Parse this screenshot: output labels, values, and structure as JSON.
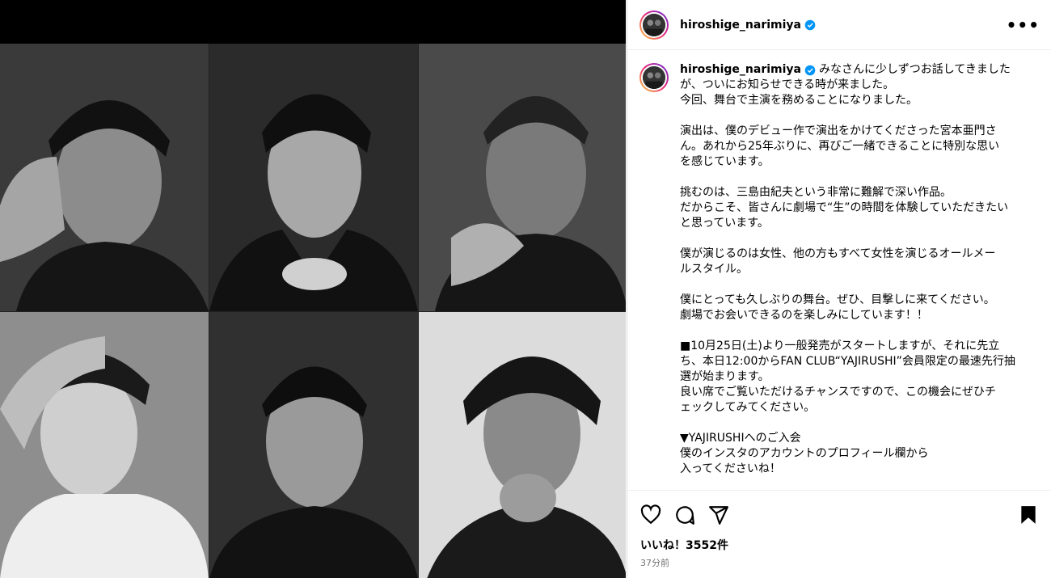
{
  "post": {
    "username": "hiroshige_narimiya",
    "verified": true,
    "more_icon": "more-horizontal-icon"
  },
  "caption": {
    "first_line": "みなさんに少しずつお話してきました",
    "lines": [
      "が、ついにお知らせできる時が来ました。",
      "今回、舞台で主演を務めることになりました。",
      "",
      "演出は、僕のデビュー作で演出をかけてくださった宮本亜門さ",
      "ん。あれから25年ぶりに、再びご一緒できることに特別な思い",
      "を感じています。",
      "",
      "挑むのは、三島由紀夫という非常に難解で深い作品。",
      "だからこそ、皆さんに劇場で“生”の時間を体験していただきたい",
      "と思っています。",
      "",
      "僕が演じるのは女性、他の方もすべて女性を演じるオールメー",
      "ルスタイル。",
      "",
      "僕にとっても久しぶりの舞台。ぜひ、目撃しに来てください。",
      "劇場でお会いできるのを楽しみにしています！！",
      "",
      "■10月25日(土)より一般発売がスタートしますが、それに先立",
      "ち、本日12:00からFAN CLUB“YAJIRUSHI”会員限定の最速先行抽",
      "選が始まります。",
      "良い席でご覧いただけるチャンスですので、この機会にぜひチ",
      "ェックしてみてください。",
      "",
      "▼YAJIRUSHIへのご入会",
      "僕のインスタのアカウントのプロフィール欄から",
      "入ってくださいね！"
    ]
  },
  "actions": {
    "like_icon": "heart-icon",
    "comment_icon": "comment-icon",
    "share_icon": "send-icon",
    "save_icon": "bookmark-icon"
  },
  "likes": "いいね！3552件",
  "time": "37分前",
  "colors": {
    "verified": "#0095f6",
    "meta": "#737373"
  }
}
